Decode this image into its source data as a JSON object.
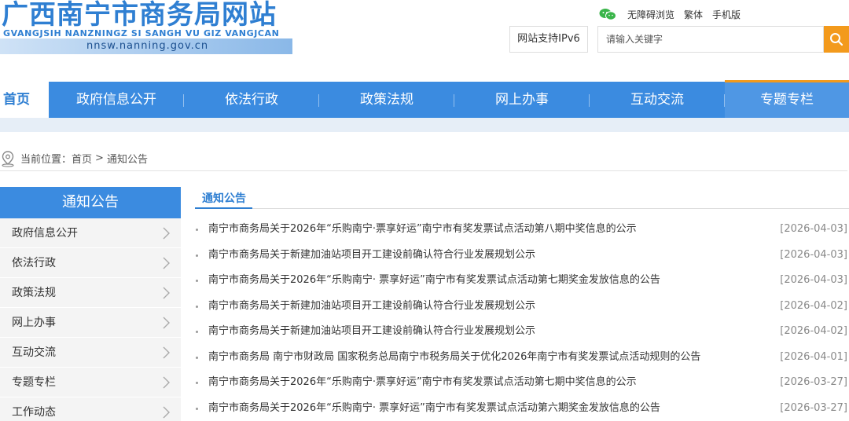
{
  "header": {
    "logo_cn": "广西南宁市商务局网站",
    "logo_zhuang": "GVANGJSIH NANZNINGZ SI  SANGH VU GIZ VANGJCAN",
    "logo_url": "nnsw.nanning.gov.cn",
    "wechat_icon": "wechat-icon",
    "links": [
      "无障碍浏览",
      "繁体",
      "手机版"
    ],
    "ipv6_label": "网站支持IPv6",
    "search_placeholder": "请输入关键字",
    "search_icon": "search-icon",
    "accent_color": "#3b8be0",
    "search_color": "#f39a1c"
  },
  "nav": {
    "items": [
      "首页",
      "政府信息公开",
      "依法行政",
      "政策法规",
      "网上办事",
      "互动交流",
      "专题专栏"
    ]
  },
  "breadcrumb": {
    "label": "当前位置：",
    "home": "首页",
    "separator": ">",
    "current": "通知公告"
  },
  "sidebar": {
    "title": "通知公告",
    "items": [
      "政府信息公开",
      "依法行政",
      "政策法规",
      "网上办事",
      "互动交流",
      "专题专栏",
      "工作动态"
    ]
  },
  "main": {
    "title": "通知公告",
    "items": [
      {
        "title": "南宁市商务局关于2026年“乐购南宁·票享好运”南宁市有奖发票试点活动第八期中奖信息的公示",
        "date": "[2026-04-03]"
      },
      {
        "title": "南宁市商务局关于新建加油站项目开工建设前确认符合行业发展规划公示",
        "date": "[2026-04-03]"
      },
      {
        "title": "南宁市商务局关于2026年“乐购南宁· 票享好运”南宁市有奖发票试点活动第七期奖金发放信息的公告",
        "date": "[2026-04-03]"
      },
      {
        "title": "南宁市商务局关于新建加油站项目开工建设前确认符合行业发展规划公示",
        "date": "[2026-04-02]"
      },
      {
        "title": "南宁市商务局关于新建加油站项目开工建设前确认符合行业发展规划公示",
        "date": "[2026-04-02]"
      },
      {
        "title": "南宁市商务局 南宁市财政局 国家税务总局南宁市税务局关于优化2026年南宁市有奖发票试点活动规则的公告",
        "date": "[2026-04-01]"
      },
      {
        "title": "南宁市商务局关于2026年“乐购南宁·票享好运”南宁市有奖发票试点活动第七期中奖信息的公示",
        "date": "[2026-03-27]"
      },
      {
        "title": "南宁市商务局关于2026年“乐购南宁· 票享好运”南宁市有奖发票试点活动第六期奖金发放信息的公告",
        "date": "[2026-03-27]"
      }
    ]
  }
}
